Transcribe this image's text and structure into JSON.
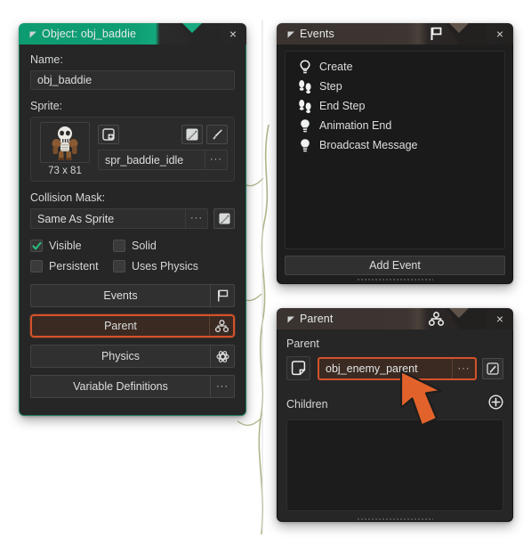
{
  "theme": {
    "accent_teal": "#0f9e75",
    "accent_orange": "#d4532a",
    "panel_bg": "#262626",
    "list_bg": "#1a1a1a",
    "text": "#dcdedd"
  },
  "object_panel": {
    "title": "Object: obj_baddie",
    "caret_icon": "triangle-collapse-icon",
    "close_icon": "close-icon",
    "close_label": "×",
    "name_label": "Name:",
    "name_value": "obj_baddie",
    "sprite_label": "Sprite:",
    "sprite": {
      "thumb_icon": "sprite-thumbnail-skeleton",
      "dimensions": "73 x 81",
      "new_sprite_icon": "new-sprite-icon",
      "edit_sprite_icon": "edit-sprite-icon",
      "paint_sprite_icon": "paint-brush-icon",
      "name_value": "spr_baddie_idle",
      "menu_label": "···"
    },
    "collision": {
      "label": "Collision Mask:",
      "value": "Same As Sprite",
      "menu_label": "···",
      "edit_icon": "edit-mask-icon"
    },
    "checkboxes": [
      {
        "label": "Visible",
        "checked": true,
        "icon": "checkmark-icon"
      },
      {
        "label": "Solid",
        "checked": false,
        "icon": ""
      },
      {
        "label": "Persistent",
        "checked": false,
        "icon": ""
      },
      {
        "label": "Uses Physics",
        "checked": false,
        "icon": ""
      }
    ],
    "buttons": [
      {
        "label": "Events",
        "icon": "flag-icon",
        "highlighted": false
      },
      {
        "label": "Parent",
        "icon": "parent-hierarchy-icon",
        "highlighted": true
      },
      {
        "label": "Physics",
        "icon": "physics-atom-icon",
        "highlighted": false
      },
      {
        "label": "Variable Definitions",
        "icon": "ellipsis-icon",
        "highlighted": false
      }
    ]
  },
  "events_panel": {
    "title": "Events",
    "caret_icon": "triangle-collapse-icon",
    "header_icon": "flag-icon",
    "close_label": "×",
    "close_icon": "close-icon",
    "items": [
      {
        "label": "Create",
        "icon": "lightbulb-outline-icon"
      },
      {
        "label": "Step",
        "icon": "footsteps-icon"
      },
      {
        "label": "End Step",
        "icon": "footsteps-icon"
      },
      {
        "label": "Animation End",
        "icon": "lightbulb-filled-icon"
      },
      {
        "label": "Broadcast Message",
        "icon": "lightbulb-filled-icon"
      }
    ],
    "add_event_label": "Add Event",
    "resize_grip_icon": "resize-grip-icon"
  },
  "parent_panel": {
    "title": "Parent",
    "caret_icon": "triangle-collapse-icon",
    "header_icon": "parent-hierarchy-icon",
    "close_label": "×",
    "close_icon": "close-icon",
    "parent_label": "Parent",
    "parent_object_icon": "object-resource-icon",
    "parent_value": "obj_enemy_parent",
    "parent_menu_label": "···",
    "parent_edit_icon": "edit-parent-icon",
    "children_label": "Children",
    "children_add_icon": "plus-circle-icon",
    "children_items": [],
    "resize_grip_icon": "resize-grip-icon"
  },
  "cursor": {
    "icon": "mouse-cursor-arrow",
    "color": "#e2622b"
  }
}
